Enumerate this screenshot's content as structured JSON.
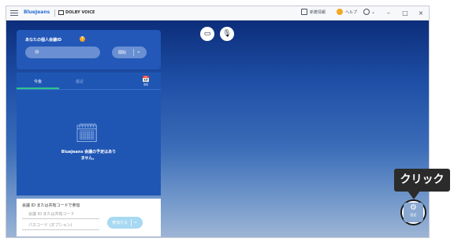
{
  "titlebar": {
    "brand": "BlueJeans",
    "dolby": "DOLBY VOICE",
    "whats_new": "新着情報",
    "help": "ヘルプ",
    "minimize": "–",
    "maximize": "□",
    "close": "×"
  },
  "meeting_panel": {
    "title": "あなたの個人会議ID",
    "help_badge": "?",
    "link_icon": "⊝",
    "start_label": "開始",
    "start_chevron": "⌄"
  },
  "schedule_panel": {
    "tabs": [
      {
        "label": "今後"
      },
      {
        "label": "最近"
      }
    ],
    "calendar_icon": "📅",
    "calendar_label": "追加",
    "empty_line1": "BlueJeans 会議の予定はあり",
    "empty_line2": "ません。"
  },
  "join_panel": {
    "title": "会議 ID または共有コードで参加",
    "id_placeholder": "会議 ID または共有コード",
    "passcode_placeholder": "パスコード (オプション)",
    "join_label": "参加する",
    "join_chevron": "⌄"
  },
  "media": {
    "video_icon": "▭",
    "mic_icon": "🎙"
  },
  "settings": {
    "icon": "⚙",
    "label": "設定"
  },
  "callout": {
    "text": "クリック"
  }
}
